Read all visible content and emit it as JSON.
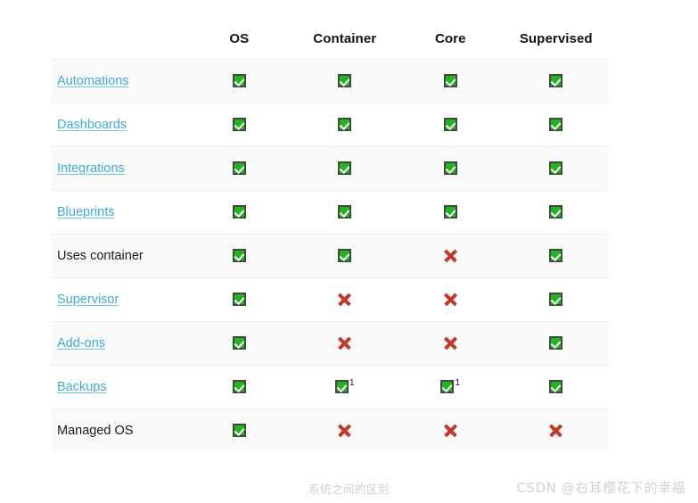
{
  "table": {
    "columns": [
      {
        "key": "feature",
        "label": ""
      },
      {
        "key": "os",
        "label": "OS"
      },
      {
        "key": "container",
        "label": "Container"
      },
      {
        "key": "core",
        "label": "Core"
      },
      {
        "key": "supervised",
        "label": "Supervised"
      }
    ],
    "rows": [
      {
        "feature": "Automations",
        "link": true,
        "tall": false,
        "os": "check",
        "container": "check",
        "core": "check",
        "supervised": "check",
        "os_note": "",
        "container_note": "",
        "core_note": "",
        "supervised_note": ""
      },
      {
        "feature": "Dashboards",
        "link": true,
        "tall": false,
        "os": "check",
        "container": "check",
        "core": "check",
        "supervised": "check",
        "os_note": "",
        "container_note": "",
        "core_note": "",
        "supervised_note": ""
      },
      {
        "feature": "Integrations",
        "link": true,
        "tall": false,
        "os": "check",
        "container": "check",
        "core": "check",
        "supervised": "check",
        "os_note": "",
        "container_note": "",
        "core_note": "",
        "supervised_note": ""
      },
      {
        "feature": "Blueprints",
        "link": true,
        "tall": false,
        "os": "check",
        "container": "check",
        "core": "check",
        "supervised": "check",
        "os_note": "",
        "container_note": "",
        "core_note": "",
        "supervised_note": ""
      },
      {
        "feature": "Uses container",
        "link": false,
        "tall": true,
        "os": "check",
        "container": "check",
        "core": "cross",
        "supervised": "check",
        "os_note": "",
        "container_note": "",
        "core_note": "",
        "supervised_note": ""
      },
      {
        "feature": "Supervisor",
        "link": true,
        "tall": false,
        "os": "check",
        "container": "cross",
        "core": "cross",
        "supervised": "check",
        "os_note": "",
        "container_note": "",
        "core_note": "",
        "supervised_note": ""
      },
      {
        "feature": "Add-ons",
        "link": true,
        "tall": false,
        "os": "check",
        "container": "cross",
        "core": "cross",
        "supervised": "check",
        "os_note": "",
        "container_note": "",
        "core_note": "",
        "supervised_note": ""
      },
      {
        "feature": "Backups",
        "link": true,
        "tall": false,
        "os": "check",
        "container": "check",
        "core": "check",
        "supervised": "check",
        "os_note": "",
        "container_note": "1",
        "core_note": "1",
        "supervised_note": ""
      },
      {
        "feature": "Managed OS",
        "link": false,
        "tall": false,
        "os": "check",
        "container": "cross",
        "core": "cross",
        "supervised": "cross",
        "os_note": "",
        "container_note": "",
        "core_note": "",
        "supervised_note": ""
      }
    ]
  },
  "caption": "系统之间的区别",
  "watermark": "CSDN @右耳樱花下的幸福",
  "icons": {
    "check": "green-check-icon",
    "cross": "red-cross-icon"
  },
  "colors": {
    "link": "#3fadd8",
    "check_green": "#22b520",
    "cross_red": "#c0392b",
    "row_stripe": "#fafafa",
    "page_background": "#ffffff",
    "caption_gray": "#cfcfcf"
  }
}
